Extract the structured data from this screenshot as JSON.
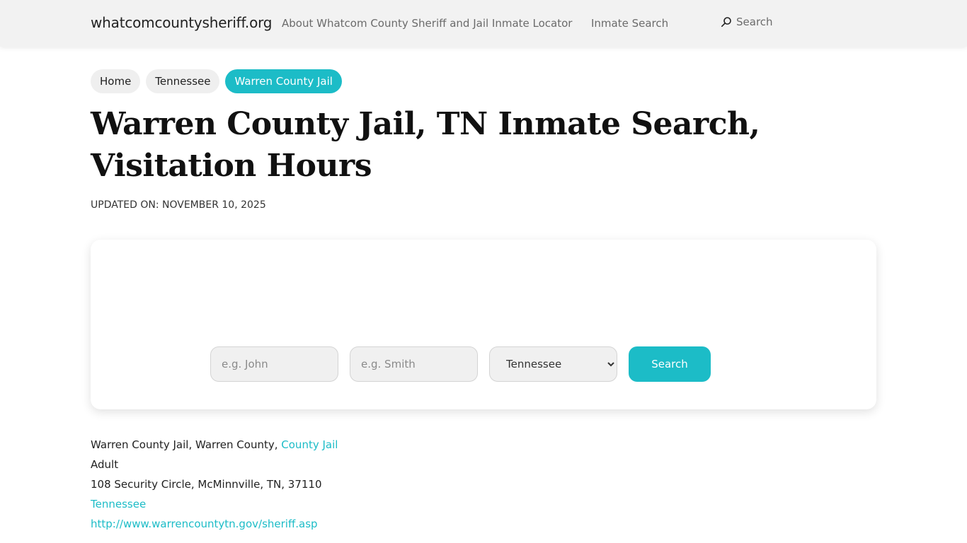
{
  "header": {
    "brand": "whatcomcountysheriff.org",
    "nav": {
      "about": "About Whatcom County Sheriff and Jail Inmate Locator",
      "inmate_search": "Inmate Search",
      "search": "Search"
    }
  },
  "breadcrumb": [
    "Home",
    "Tennessee",
    "Warren County Jail"
  ],
  "page_title": "Warren County Jail, TN Inmate Search, Visitation Hours",
  "updated": "UPDATED ON: NOVEMBER 10, 2025",
  "search_form": {
    "first_name_placeholder": "e.g. John",
    "last_name_placeholder": "e.g. Smith",
    "state_selected": "Tennessee",
    "button_label": "Search"
  },
  "facility": {
    "line1_prefix": "Warren County Jail, Warren County,",
    "type_link": "County Jail",
    "category": "Adult",
    "address": "108 Security Circle, McMinnville, TN, 37110",
    "state_link": "Tennessee",
    "website": "http://www.warrencountytn.gov/sheriff.asp"
  },
  "colors": {
    "accent": "#1cbcc7",
    "topbar_bg": "#f2f2f2"
  },
  "icons": {
    "nav_search": "search-icon"
  }
}
